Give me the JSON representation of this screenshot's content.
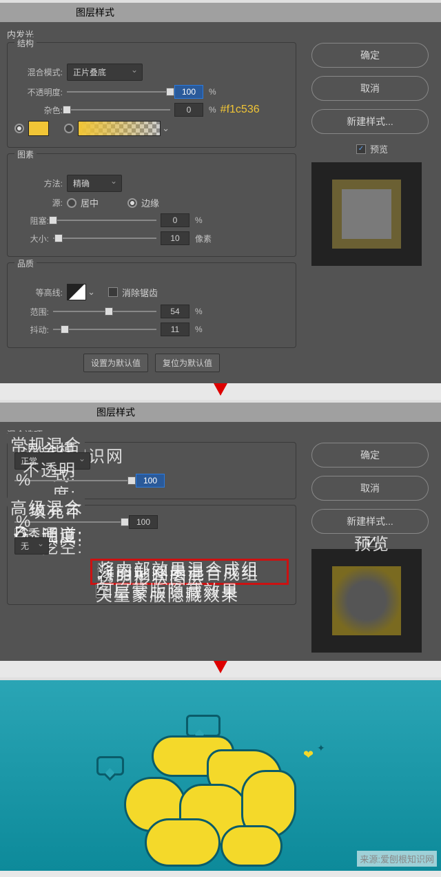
{
  "panel1": {
    "header": "图层样式",
    "title": "内发光",
    "structure": {
      "legend": "结构",
      "blend_label": "混合模式:",
      "blend_value": "正片叠底",
      "opacity_label": "不透明度:",
      "opacity_value": "100",
      "percent": "%",
      "noise_label": "杂色:",
      "noise_value": "0",
      "color_note": "#f1c536"
    },
    "elements": {
      "legend": "图素",
      "method_label": "方法:",
      "method_value": "精确",
      "source_label": "源:",
      "center": "居中",
      "edge": "边缘",
      "choke_label": "阻塞:",
      "choke_value": "0",
      "size_label": "大小:",
      "size_value": "10",
      "px": "像素"
    },
    "quality": {
      "legend": "品质",
      "contour_label": "等高线:",
      "antialias": "消除锯齿",
      "range_label": "范围:",
      "range_value": "54",
      "jitter_label": "抖动:",
      "jitter_value": "11"
    },
    "set_default": "设置为默认值",
    "reset_default": "复位为默认值"
  },
  "buttons": {
    "ok": "确定",
    "cancel": "取消",
    "new_style": "新建样式...",
    "preview": "预览"
  },
  "panel2": {
    "header": "图层样式",
    "title": "混合选项",
    "general": {
      "legend": "常规混合",
      "blend_label": "混合模式:",
      "blend_value": "正常",
      "opacity_label": "不透明度:",
      "opacity_value": "100"
    },
    "advanced": {
      "legend": "高级混合",
      "fill_label": "填充不透明度:",
      "fill_value": "100",
      "channels_label": "通道:",
      "r": "R",
      "g": "G",
      "b": "B",
      "knockout_label": "挖空:",
      "knockout_value": "无",
      "cb1": "将内部效果混合成组",
      "cb2": "将剪贴图层混合成组",
      "cb3": "透明形状图层",
      "cb4": "图层蒙版隐藏效果",
      "cb5": "矢量蒙版隐藏效果"
    }
  },
  "watermark": "爱刨知识网",
  "source": "来源:爱刨根知识网",
  "chart_data": null
}
